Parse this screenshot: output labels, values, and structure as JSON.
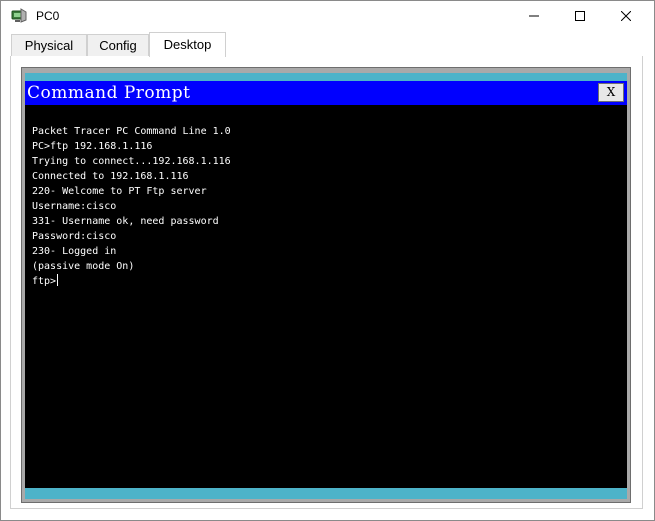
{
  "window": {
    "title": "PC0",
    "icon": "pc-device-icon",
    "controls": {
      "minimize": "minimize-icon",
      "maximize": "maximize-icon",
      "close": "close-icon"
    }
  },
  "tabs": [
    {
      "label": "Physical",
      "selected": false
    },
    {
      "label": "Config",
      "selected": false
    },
    {
      "label": "Desktop",
      "selected": true
    }
  ],
  "command_prompt": {
    "title": "Command Prompt",
    "close_label": "X",
    "lines": [
      "Packet Tracer PC Command Line 1.0",
      "PC>ftp 192.168.1.116",
      "Trying to connect...192.168.1.116",
      "Connected to 192.168.1.116",
      "220- Welcome to PT Ftp server",
      "Username:cisco",
      "331- Username ok, need password",
      "Password:cisco",
      "230- Logged in",
      "(passive mode On)"
    ],
    "prompt": "ftp>"
  },
  "colors": {
    "cmd_titlebar": "#0000ff",
    "terminal_bg": "#000000",
    "terminal_fg": "#ffffff",
    "desktop_bg": "#4db3c9"
  }
}
